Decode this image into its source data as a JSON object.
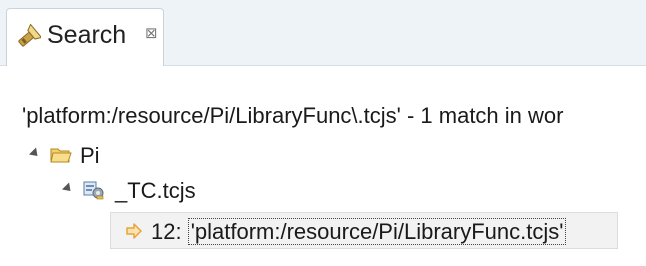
{
  "tab": {
    "title": "Search",
    "icon": "search-flashlight-icon",
    "close_glyph": "⊠"
  },
  "summary": {
    "text": "'platform:/resource/Pi/LibraryFunc\\.tcjs' - 1 match in wor"
  },
  "tree": {
    "project": {
      "label": "Pi",
      "icon": "open-folder-icon"
    },
    "file": {
      "label": "_TC.tcjs",
      "icon": "test-file-icon"
    },
    "match": {
      "line_prefix": "12: ",
      "open_quote": "'",
      "text": "platform:/resource/Pi/LibraryFunc.tcjs",
      "close_quote": "'",
      "icon": "match-arrow-icon"
    }
  },
  "colors": {
    "tab_band": "#eef3f8",
    "folder": "#e8b84a",
    "match_arrow": "#e8a33a"
  }
}
